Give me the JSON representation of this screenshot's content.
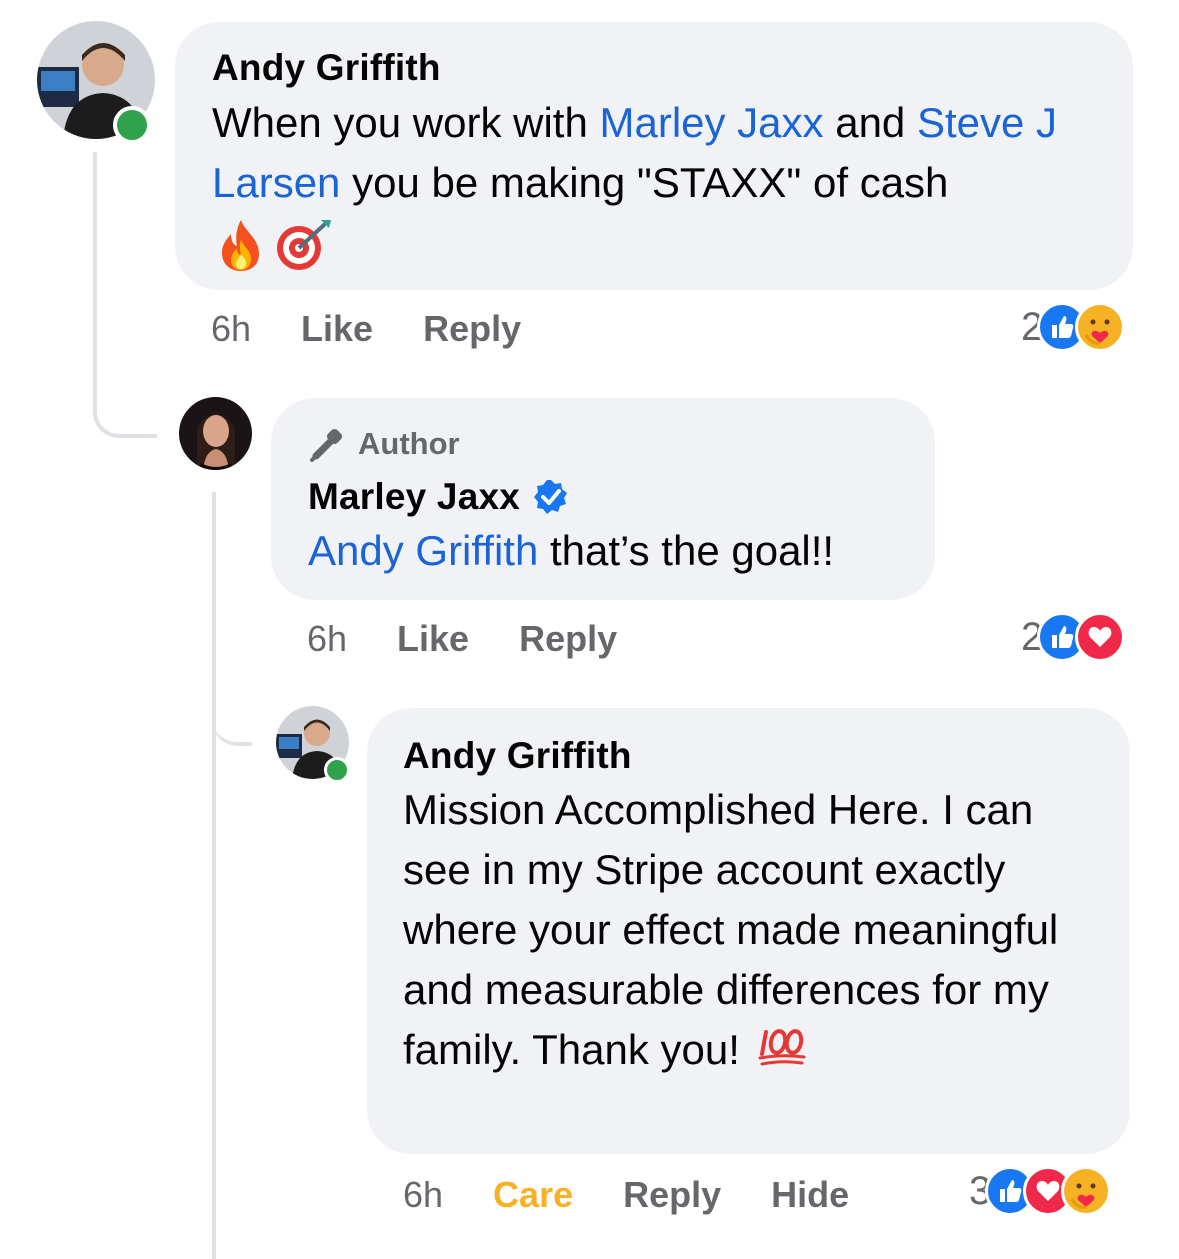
{
  "comments": [
    {
      "author": "Andy Griffith",
      "text_parts": [
        "When you work with ",
        "Marley Jaxx",
        " and ",
        "Steve J Larsen",
        " you be making \"STAXX\" of cash"
      ],
      "emojis": [
        "fire",
        "direct-hit"
      ],
      "time": "6h",
      "actions": [
        "Like",
        "Reply"
      ],
      "reaction_count": "2",
      "reactions": [
        "like",
        "care"
      ]
    },
    {
      "badge": "Author",
      "author": "Marley Jaxx",
      "verified": true,
      "text_parts": [
        "Andy Griffith",
        " that’s the goal!!"
      ],
      "time": "6h",
      "actions": [
        "Like",
        "Reply"
      ],
      "reaction_count": "2",
      "reactions": [
        "like",
        "love"
      ]
    },
    {
      "author": "Andy Griffith",
      "text": "Mission Accomplished Here. I can see in my Stripe account exactly where your effect made meaningful and measurable differences for my family. Thank you!",
      "emoji": "100",
      "time": "6h",
      "actions": [
        "Care",
        "Reply",
        "Hide"
      ],
      "reaction_count": "3",
      "reactions": [
        "like",
        "love",
        "care"
      ]
    }
  ],
  "colors": {
    "mention": "#1a64d6",
    "bubble": "#f0f2f5",
    "meta": "#65676b",
    "care": "#f7b125",
    "online": "#31a24c",
    "like": "#1877f2",
    "love": "#f02849"
  }
}
